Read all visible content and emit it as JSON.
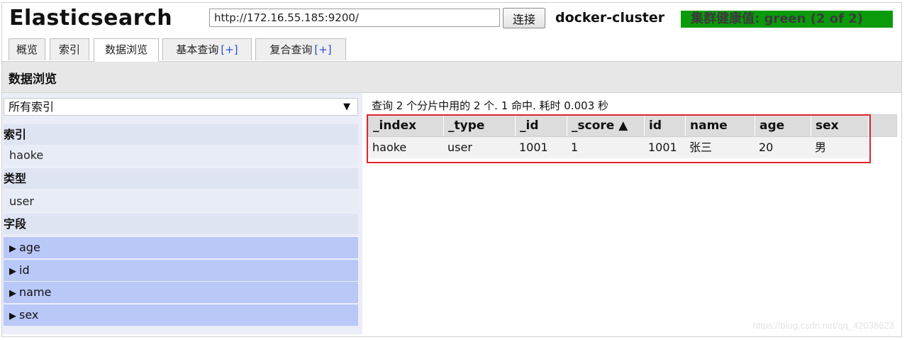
{
  "header": {
    "logo": "Elasticsearch",
    "url_value": "http://172.16.55.185:9200/",
    "connect_label": "连接",
    "cluster_name": "docker-cluster",
    "health_text": "集群健康值: green (2 of 2)",
    "health_color": "#0a9b0a"
  },
  "tabs": [
    {
      "label": "概览",
      "plus": ""
    },
    {
      "label": "索引",
      "plus": ""
    },
    {
      "label": "数据浏览",
      "plus": "",
      "active": true
    },
    {
      "label": "基本查询",
      "plus": "[+]"
    },
    {
      "label": "复合查询",
      "plus": "[+]"
    }
  ],
  "section_title": "数据浏览",
  "sidebar": {
    "index_select": "所有索引",
    "select_arrow": "▼",
    "index_header": "索引",
    "index_items": [
      "haoke"
    ],
    "type_header": "类型",
    "type_items": [
      "user"
    ],
    "field_header": "字段",
    "field_items": [
      "age",
      "id",
      "name",
      "sex"
    ],
    "expand_icon": "▶"
  },
  "results": {
    "summary": "查询 2 个分片中用的 2 个. 1 命中. 耗时 0.003 秒",
    "columns": [
      "_index",
      "_type",
      "_id",
      "_score ▲",
      "id",
      "name",
      "age",
      "sex"
    ],
    "rows": [
      [
        "haoke",
        "user",
        "1001",
        "1",
        "1001",
        "张三",
        "20",
        "男"
      ]
    ]
  },
  "watermark": "https://blog.csdn.net/qq_42038623"
}
